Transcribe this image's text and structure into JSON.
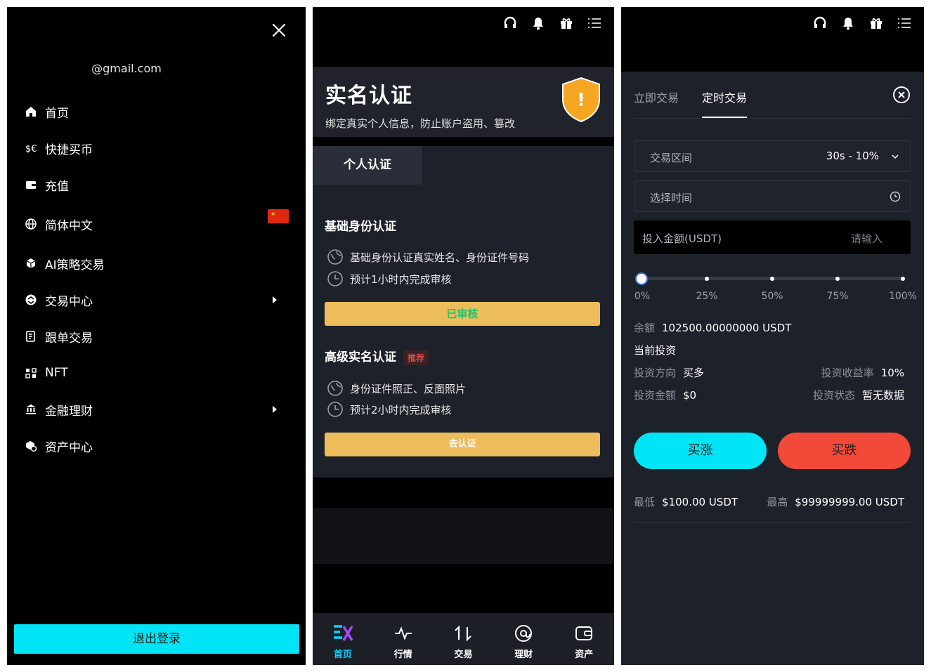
{
  "drawer": {
    "email": "@gmail.com",
    "menu": [
      {
        "label": "首页",
        "icon": "home-icon"
      },
      {
        "label": "快捷买币",
        "icon": "exchange-icon"
      },
      {
        "label": "充值",
        "icon": "wallet-icon"
      },
      {
        "label": "简体中文",
        "icon": "globe-icon"
      },
      {
        "label": "AI策略交易",
        "icon": "cube-icon"
      },
      {
        "label": "交易中心",
        "icon": "trade-icon"
      },
      {
        "label": "跟单交易",
        "icon": "document-icon"
      },
      {
        "label": "NFT",
        "icon": "nft-icon"
      },
      {
        "label": "金融理财",
        "icon": "bank-icon"
      },
      {
        "label": "资产中心",
        "icon": "asset-icon"
      }
    ],
    "logout_label": "退出登录"
  },
  "kyc": {
    "title": "实名认证",
    "subtitle": "绑定真实个人信息，防止账户盗用、篡改",
    "shield_mark": "!",
    "tab": "个人认证",
    "basic": {
      "title": "基础身份认证",
      "line1": "基础身份认证真实姓名、身份证件号码",
      "line2": "预计1小时内完成审核",
      "button": "已审核"
    },
    "advanced": {
      "title": "高级实名认证",
      "badge": "推荐",
      "line1": "身份证件照正、反面照片",
      "line2": "预计2小时内完成审核",
      "button": "去认证"
    },
    "tabbar": [
      {
        "label": "首页",
        "icon": "brand-logo-icon"
      },
      {
        "label": "行情",
        "icon": "pulse-icon"
      },
      {
        "label": "交易",
        "icon": "swap-icon"
      },
      {
        "label": "理财",
        "icon": "at-icon"
      },
      {
        "label": "资产",
        "icon": "wallet-icon"
      }
    ]
  },
  "order": {
    "tabs": [
      "立即交易",
      "定时交易"
    ],
    "range_label": "交易区间",
    "range_value": "30s - 10%",
    "time_label": "选择时间",
    "amount_label": "投入金额(USDT)",
    "amount_placeholder": "请输入",
    "slider_labels": [
      "0%",
      "25%",
      "50%",
      "75%",
      "100%"
    ],
    "slider_value": 0,
    "balance_key": "余额",
    "balance_value": "102500.00000000 USDT",
    "current_title": "当前投资",
    "direction_key": "投资方向",
    "direction_value": "买多",
    "rate_key": "投资收益率",
    "rate_value": "10%",
    "amount_key": "投资金额",
    "amount_value": "$0",
    "status_key": "投资状态",
    "status_value": "暂无数据",
    "buy_up": "买涨",
    "buy_down": "买跌",
    "min_key": "最低",
    "min_value": "$100.00 USDT",
    "max_key": "最高",
    "max_value": "$99999999.00 USDT"
  },
  "colors": {
    "accent_cyan": "#00e5f5",
    "gold": "#edbd5c",
    "down_red": "#f24a38",
    "active_tab": "#00d6ff",
    "shield_orange": "#f5a623"
  }
}
